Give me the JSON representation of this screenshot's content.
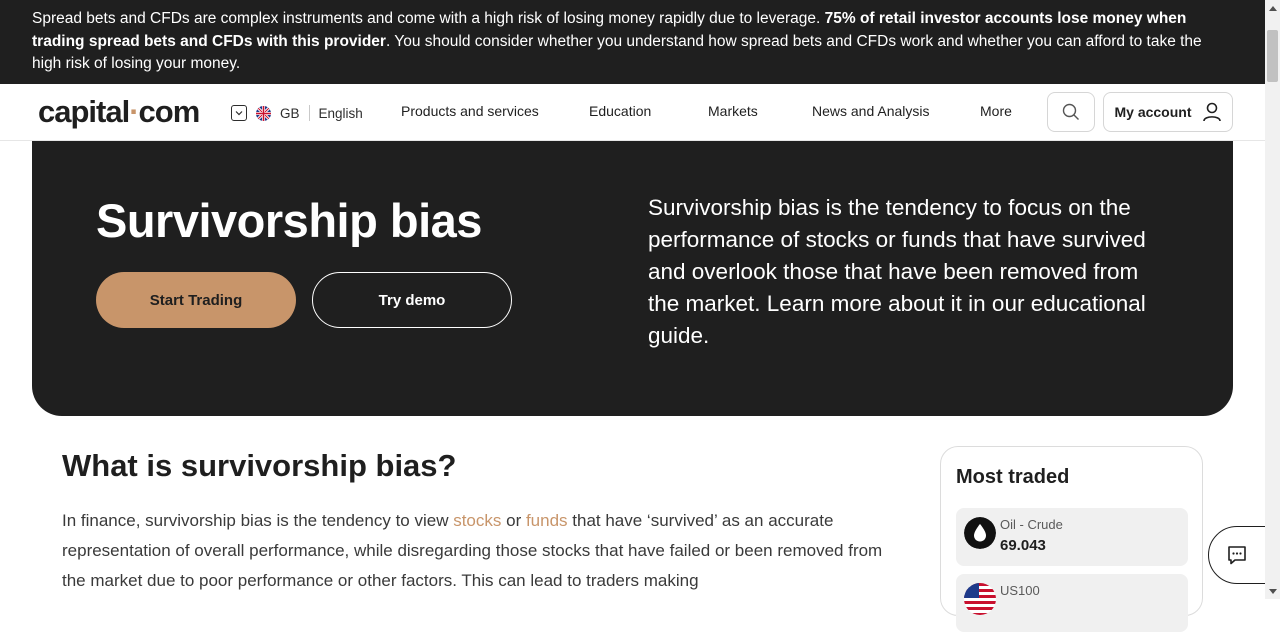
{
  "risk_banner": {
    "text_start": "Spread bets and CFDs are complex instruments and come with a high risk of losing money rapidly due to leverage. ",
    "text_bold": "75% of retail investor accounts lose money when trading spread bets and CFDs with this provider",
    "text_end": ". You should consider whether you understand how spread bets and CFDs work and whether you can afford to take the high risk of losing your money."
  },
  "header": {
    "logo_main": "capital",
    "logo_dot": "·",
    "logo_end": "com",
    "region": "GB",
    "language": "English",
    "nav": [
      "Products and services",
      "Education",
      "Markets",
      "News and Analysis",
      "More"
    ],
    "account_label": "My account"
  },
  "hero": {
    "title": "Survivorship bias",
    "start_trading": "Start Trading",
    "try_demo": "Try demo",
    "description": "Survivorship bias is the tendency to focus on the performance of stocks or funds that have survived and overlook those that have been removed from the market. Learn more about it in our educational guide."
  },
  "article": {
    "title": "What is survivorship bias?",
    "p1_a": "In finance, survivorship bias is the tendency to view ",
    "p1_link1": "stocks",
    "p1_b": " or ",
    "p1_link2": "funds",
    "p1_c": " that have ‘survived’ as an accurate representation of overall performance, while disregarding those stocks that have failed or been removed from the market due to poor performance or other factors. This can lead to traders making"
  },
  "most_traded": {
    "title": "Most traded",
    "items": [
      {
        "name": "Oil - Crude",
        "price": "69.043",
        "icon": "oil-drop-icon"
      },
      {
        "name": "US100",
        "price": "",
        "icon": "us-flag-icon"
      }
    ]
  },
  "colors": {
    "dark": "#1f1f1f",
    "accent": "#c8956a"
  }
}
